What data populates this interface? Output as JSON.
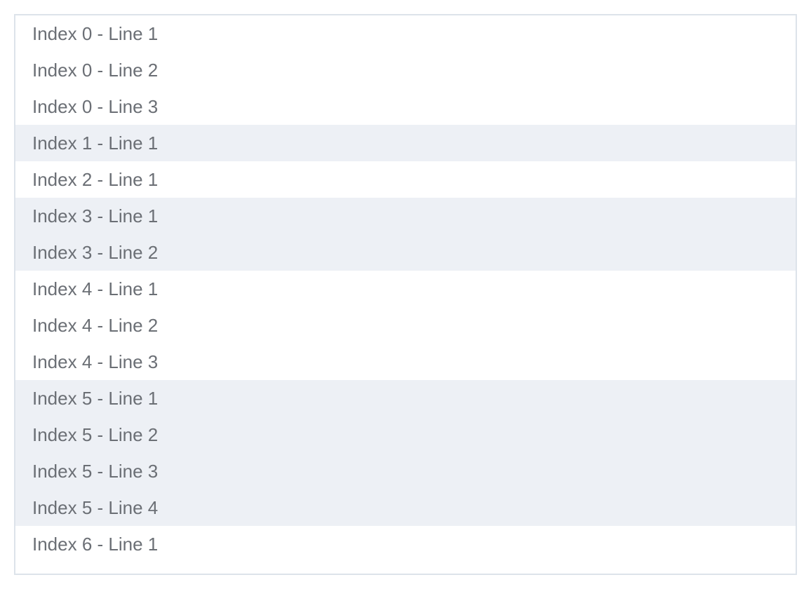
{
  "list": {
    "groups": [
      {
        "index": 0,
        "lines": [
          "Index 0 - Line 1",
          "Index 0 - Line 2",
          "Index 0 - Line 3"
        ]
      },
      {
        "index": 1,
        "lines": [
          "Index 1 - Line 1"
        ]
      },
      {
        "index": 2,
        "lines": [
          "Index 2 - Line 1"
        ]
      },
      {
        "index": 3,
        "lines": [
          "Index 3 - Line 1",
          "Index 3 - Line 2"
        ]
      },
      {
        "index": 4,
        "lines": [
          "Index 4 - Line 1",
          "Index 4 - Line 2",
          "Index 4 - Line 3"
        ]
      },
      {
        "index": 5,
        "lines": [
          "Index 5 - Line 1",
          "Index 5 - Line 2",
          "Index 5 - Line 3",
          "Index 5 - Line 4"
        ]
      },
      {
        "index": 6,
        "lines": [
          "Index 6 - Line 1"
        ]
      }
    ]
  },
  "colors": {
    "row_even": "#ffffff",
    "row_odd": "#edf0f5",
    "text": "#6b6f75",
    "border": "#dde3ea"
  }
}
